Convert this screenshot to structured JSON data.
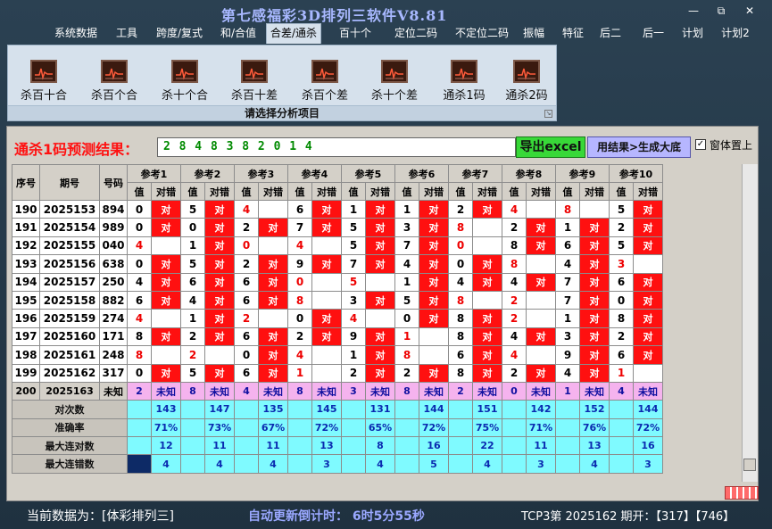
{
  "title": "第七感福彩3D排列三软件V8.81",
  "window_buttons": [
    "—",
    "⧉",
    "✕"
  ],
  "menu": [
    "系统数据",
    "工具",
    "跨度/复式",
    "和/合值",
    "合差/通杀",
    "百十个",
    "定位二码",
    "不定位二码",
    "振幅",
    "特征",
    "后二",
    "后一",
    "计划",
    "计划2"
  ],
  "menu_active": 4,
  "ribbon": {
    "buttons": [
      "杀百十合",
      "杀百个合",
      "杀十个合",
      "杀百十差",
      "杀百个差",
      "杀十个差",
      "通杀1码",
      "通杀2码"
    ],
    "group_label": "请选择分析项目"
  },
  "prediction": {
    "label": "通杀1码预测结果：",
    "value": "2 8 4 8 3 8 2 0 1 4",
    "export_button": "导出excel",
    "generate_button": "用结果>生成大底",
    "checkbox_label": "窗体置上",
    "checkbox_checked": true
  },
  "table": {
    "head_main": [
      "序号",
      "期号",
      "号码"
    ],
    "refs": [
      "参考1",
      "参考2",
      "参考3",
      "参考4",
      "参考5",
      "参考6",
      "参考7",
      "参考8",
      "参考9",
      "参考10"
    ],
    "sub": [
      "值",
      "对错"
    ],
    "mark": "对",
    "rows": [
      {
        "seq": "190",
        "period": "2025153",
        "num": "894",
        "cells": [
          [
            "0",
            "R"
          ],
          [
            "5",
            "R"
          ],
          [
            "4r",
            ""
          ],
          [
            "6",
            "R"
          ],
          [
            "1",
            "R"
          ],
          [
            "1",
            "R"
          ],
          [
            "2",
            "R"
          ],
          [
            "4r",
            ""
          ],
          [
            "8r",
            ""
          ],
          [
            "5",
            "R"
          ]
        ]
      },
      {
        "seq": "191",
        "period": "2025154",
        "num": "989",
        "cells": [
          [
            "0",
            "R"
          ],
          [
            "0",
            "R"
          ],
          [
            "2",
            "R"
          ],
          [
            "7",
            "R"
          ],
          [
            "5",
            "R"
          ],
          [
            "3",
            "R"
          ],
          [
            "8r",
            ""
          ],
          [
            "2",
            "R"
          ],
          [
            "1",
            "R"
          ],
          [
            "2",
            "R"
          ]
        ]
      },
      {
        "seq": "192",
        "period": "2025155",
        "num": "040",
        "cells": [
          [
            "4r",
            ""
          ],
          [
            "1",
            "R"
          ],
          [
            "0r",
            ""
          ],
          [
            "4r",
            ""
          ],
          [
            "5",
            "R"
          ],
          [
            "7",
            "R"
          ],
          [
            "0r",
            ""
          ],
          [
            "8",
            "R"
          ],
          [
            "6",
            "R"
          ],
          [
            "5",
            "R"
          ]
        ]
      },
      {
        "seq": "193",
        "period": "2025156",
        "num": "638",
        "cells": [
          [
            "0",
            "R"
          ],
          [
            "5",
            "R"
          ],
          [
            "2",
            "R"
          ],
          [
            "9",
            "R"
          ],
          [
            "7",
            "R"
          ],
          [
            "4",
            "R"
          ],
          [
            "0",
            "R"
          ],
          [
            "8r",
            ""
          ],
          [
            "4",
            "R"
          ],
          [
            "3r",
            ""
          ]
        ]
      },
      {
        "seq": "194",
        "period": "2025157",
        "num": "250",
        "cells": [
          [
            "4",
            "R"
          ],
          [
            "6",
            "R"
          ],
          [
            "6",
            "R"
          ],
          [
            "0r",
            ""
          ],
          [
            "5r",
            ""
          ],
          [
            "1",
            "R"
          ],
          [
            "4",
            "R"
          ],
          [
            "4",
            "R"
          ],
          [
            "7",
            "R"
          ],
          [
            "6",
            "R"
          ]
        ]
      },
      {
        "seq": "195",
        "period": "2025158",
        "num": "882",
        "cells": [
          [
            "6",
            "R"
          ],
          [
            "4",
            "R"
          ],
          [
            "6",
            "R"
          ],
          [
            "8r",
            ""
          ],
          [
            "3",
            "R"
          ],
          [
            "5",
            "R"
          ],
          [
            "8r",
            ""
          ],
          [
            "2r",
            ""
          ],
          [
            "7",
            "R"
          ],
          [
            "0",
            "R"
          ]
        ]
      },
      {
        "seq": "196",
        "period": "2025159",
        "num": "274",
        "cells": [
          [
            "4r",
            ""
          ],
          [
            "1",
            "R"
          ],
          [
            "2r",
            ""
          ],
          [
            "0",
            "R"
          ],
          [
            "4r",
            ""
          ],
          [
            "0",
            "R"
          ],
          [
            "8",
            "R"
          ],
          [
            "2r",
            ""
          ],
          [
            "1",
            "R"
          ],
          [
            "8",
            "R"
          ]
        ]
      },
      {
        "seq": "197",
        "period": "2025160",
        "num": "171",
        "cells": [
          [
            "8",
            "R"
          ],
          [
            "2",
            "R"
          ],
          [
            "6",
            "R"
          ],
          [
            "2",
            "R"
          ],
          [
            "9",
            "R"
          ],
          [
            "1r",
            ""
          ],
          [
            "8",
            "R"
          ],
          [
            "4",
            "R"
          ],
          [
            "3",
            "R"
          ],
          [
            "2",
            "R"
          ]
        ]
      },
      {
        "seq": "198",
        "period": "2025161",
        "num": "248",
        "cells": [
          [
            "8r",
            ""
          ],
          [
            "2r",
            ""
          ],
          [
            "0",
            "R"
          ],
          [
            "4r",
            ""
          ],
          [
            "1",
            "R"
          ],
          [
            "8r",
            ""
          ],
          [
            "6",
            "R"
          ],
          [
            "4r",
            ""
          ],
          [
            "9",
            "R"
          ],
          [
            "6",
            "R"
          ]
        ]
      },
      {
        "seq": "199",
        "period": "2025162",
        "num": "317",
        "cells": [
          [
            "0",
            "R"
          ],
          [
            "5",
            "R"
          ],
          [
            "6",
            "R"
          ],
          [
            "1r",
            ""
          ],
          [
            "2",
            "R"
          ],
          [
            "2",
            "R"
          ],
          [
            "8",
            "R"
          ],
          [
            "2",
            "R"
          ],
          [
            "4",
            "R"
          ],
          [
            "1r",
            ""
          ]
        ]
      },
      {
        "seq": "200",
        "period": "2025163",
        "num": "未知",
        "cells": [
          [
            "2",
            "U"
          ],
          [
            "8",
            "U"
          ],
          [
            "4",
            "U"
          ],
          [
            "8",
            "U"
          ],
          [
            "3",
            "U"
          ],
          [
            "8",
            "U"
          ],
          [
            "2",
            "U"
          ],
          [
            "0",
            "U"
          ],
          [
            "1",
            "U"
          ],
          [
            "4",
            "U"
          ]
        ]
      }
    ],
    "unknown": "未知",
    "stats": [
      {
        "label": "对次数",
        "values": [
          "143",
          "147",
          "135",
          "145",
          "131",
          "144",
          "151",
          "142",
          "152",
          "144"
        ]
      },
      {
        "label": "准确率",
        "values": [
          "71%",
          "73%",
          "67%",
          "72%",
          "65%",
          "72%",
          "75%",
          "71%",
          "76%",
          "72%"
        ]
      },
      {
        "label": "最大连对数",
        "values": [
          "12",
          "11",
          "11",
          "13",
          "8",
          "16",
          "22",
          "11",
          "13",
          "16"
        ]
      },
      {
        "label": "最大连错数",
        "values": [
          "4",
          "4",
          "4",
          "3",
          "4",
          "5",
          "4",
          "3",
          "4",
          "3"
        ]
      }
    ]
  },
  "status": {
    "current": "当前数据为：[体彩排列三]",
    "countdown": "自动更新倒计时：  6时5分55秒",
    "lottery": "TCP3第  2025162  期开：【317】【746】"
  },
  "colors": {
    "hit": "#ff1010",
    "unknown_row": "#f5b3ee",
    "stats": "#7ffaff",
    "excel_btn": "#38d838",
    "gen_btn": "#b6b6ff"
  }
}
